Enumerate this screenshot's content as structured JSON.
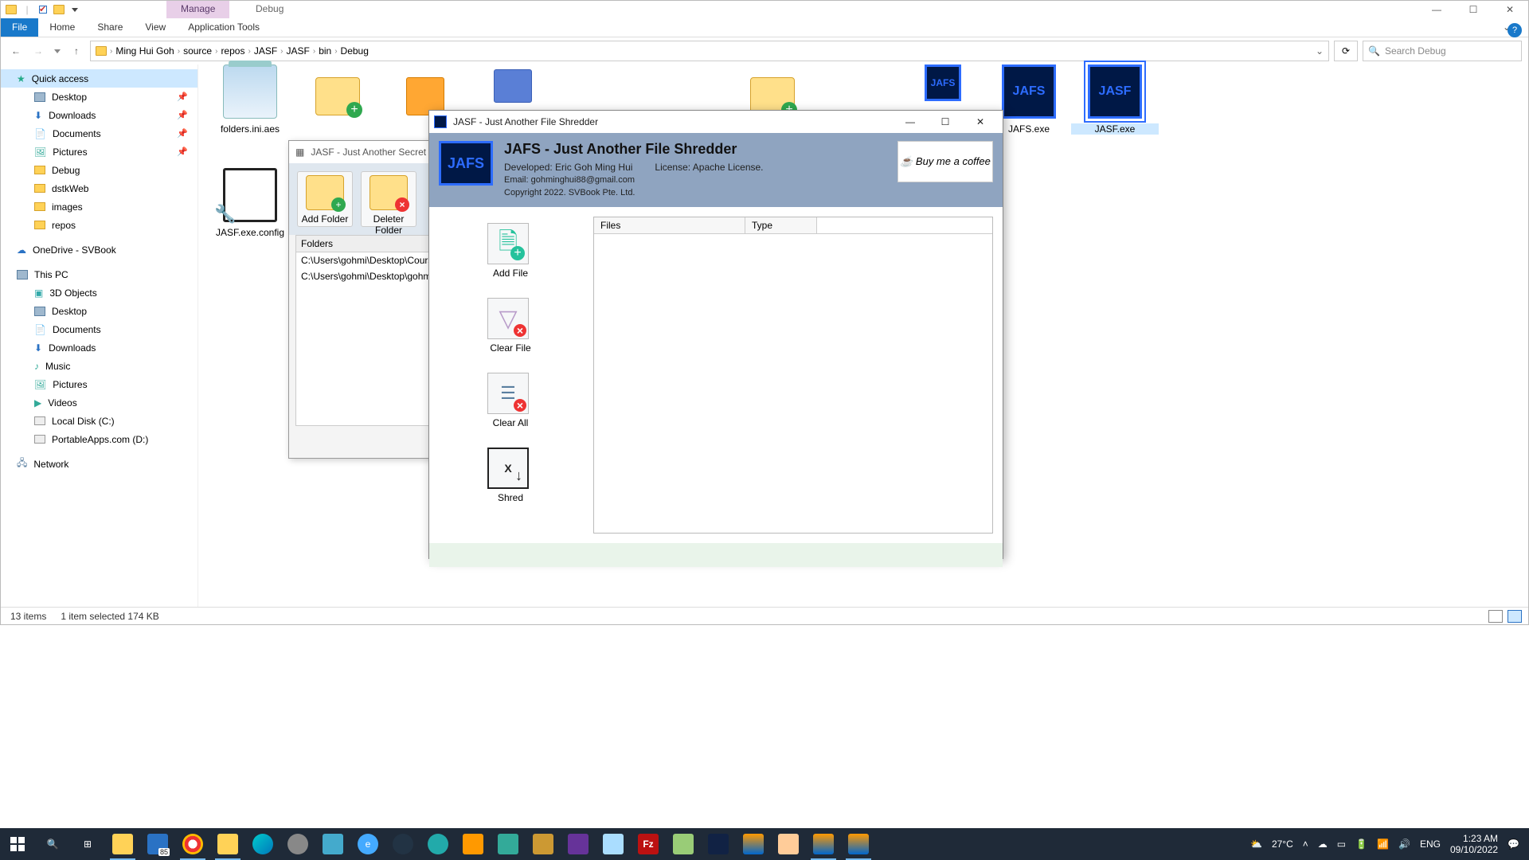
{
  "titlebar": {
    "context_tab": "Manage",
    "context_tab2": "Debug"
  },
  "ribbon": {
    "file": "File",
    "home": "Home",
    "share": "Share",
    "view": "View",
    "apptools": "Application Tools"
  },
  "breadcrumb": [
    "Ming Hui Goh",
    "source",
    "repos",
    "JASF",
    "JASF",
    "bin",
    "Debug"
  ],
  "search": {
    "placeholder": "Search Debug"
  },
  "tree": {
    "quick": "Quick access",
    "qa_items": [
      "Desktop",
      "Downloads",
      "Documents",
      "Pictures",
      "Debug",
      "dstkWeb",
      "images",
      "repos"
    ],
    "onedrive": "OneDrive - SVBook",
    "thispc": "This PC",
    "pc_items": [
      "3D Objects",
      "Desktop",
      "Documents",
      "Downloads",
      "Music",
      "Pictures",
      "Videos",
      "Local Disk (C:)",
      "PortableApps.com (D:)"
    ],
    "network": "Network"
  },
  "files": {
    "f1": "folders.ini.aes",
    "f2": "JASF.exe.config",
    "f3": "JAFS.exe",
    "f4": "JASF.exe"
  },
  "status": {
    "left": "13 items",
    "mid": "1 item selected  174 KB"
  },
  "secret": {
    "title": "JASF - Just Another Secret Fol",
    "add": "Add Folder",
    "del": "Deleter Folder",
    "hdr": "Folders",
    "r1": "C:\\Users\\gohmi\\Desktop\\Courses",
    "r2": "C:\\Users\\gohmi\\Desktop\\gohminghu"
  },
  "jafs": {
    "title": "JASF - Just Another File Shredder",
    "h": "JAFS - Just Another File Shredder",
    "dev": "Developed: Eric Goh Ming Hui",
    "lic": "License: Apache License.",
    "mail": "Email: gohminghui88@gmail.com",
    "copy": "Copyright 2022. SVBook Pte. Ltd.",
    "coffee": "☕ Buy me a coffee",
    "addf": "Add File",
    "clrf": "Clear File",
    "clra": "Clear All",
    "shrd": "Shred",
    "col1": "Files",
    "col2": "Type"
  },
  "tray": {
    "temp": "27°C",
    "lang": "ENG",
    "time": "1:23 AM",
    "date": "09/10/2022"
  }
}
